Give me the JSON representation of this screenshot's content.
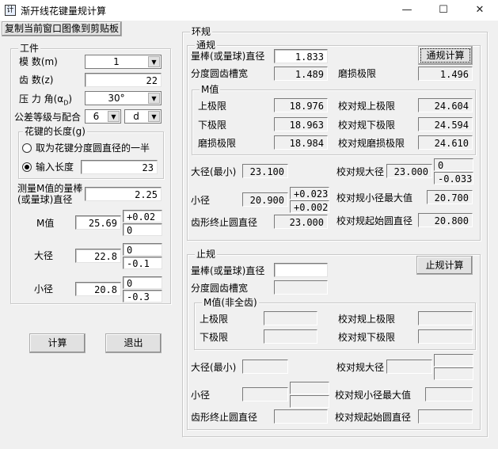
{
  "window": {
    "title": "渐开线花键量规计算",
    "minimize": "—",
    "maximize": "☐",
    "close": "✕",
    "icon": "计"
  },
  "toolbar": {
    "copy_button": "复制当前窗口图像到剪贴板"
  },
  "workpiece": {
    "title": "工件",
    "module_label": "模 数(m)",
    "module_value": "1",
    "teeth_label": "齿 数(z)",
    "teeth_value": "22",
    "pressure_label": "压 力 角(α",
    "pressure_sub": "D",
    "pressure_close": ")",
    "pressure_value": "30°",
    "tolerance_label": "公差等级与配合",
    "tolerance_grade": "6",
    "tolerance_fit": "d",
    "length_group_title": "花键的长度(g)",
    "radio_half": "取为花键分度圆直径的一半",
    "radio_input": "输入长度",
    "length_value": "23",
    "measure_label_1": "测量M值的量棒",
    "measure_label_2": "(或量球)直径",
    "measure_value": "2.25",
    "m_label": "M值",
    "m_value": "25.69",
    "m_upper": "+0.02",
    "m_lower": "0",
    "major_label": "大径",
    "major_value": "22.8",
    "major_upper": "0",
    "major_lower": "-0.1",
    "minor_label": "小径",
    "minor_value": "20.8",
    "minor_upper": "0",
    "minor_lower": "-0.3",
    "calc_button": "计算",
    "exit_button": "退出"
  },
  "ring_gauge": {
    "title": "环规",
    "go": {
      "title": "通规",
      "pin_label": "量棒(或量球)直径",
      "pin_value": "1.833",
      "calc_button": "通规计算",
      "slot_label": "分度圆齿槽宽",
      "slot_value": "1.489",
      "wear_label": "磨损极限",
      "wear_value": "1.496",
      "m_group_title": "M值",
      "upper_label": "上极限",
      "upper_value": "18.976",
      "check_upper_label": "校对规上极限",
      "check_upper_value": "24.604",
      "lower_label": "下极限",
      "lower_value": "18.963",
      "check_lower_label": "校对规下极限",
      "check_lower_value": "24.594",
      "wear_limit_label": "磨损极限",
      "wear_limit_value": "18.984",
      "check_wear_label": "校对规磨损极限",
      "check_wear_value": "24.610",
      "major_min_label": "大径(最小)",
      "major_min_value": "23.100",
      "check_major_label": "校对规大径",
      "check_major_value": "23.000",
      "check_major_upper": "0",
      "check_major_lower": "-0.033",
      "minor_label": "小径",
      "minor_value": "20.900",
      "minor_upper": "+0.023",
      "minor_lower": "+0.002",
      "check_minor_label": "校对规小径最大值",
      "check_minor_value": "20.700",
      "form_end_label": "齿形终止圆直径",
      "form_end_value": "23.000",
      "check_form_start_label": "校对规起始圆直径",
      "check_form_start_value": "20.800"
    },
    "nogo": {
      "title": "止规",
      "pin_label": "量棒(或量球)直径",
      "pin_value": "",
      "calc_button": "止规计算",
      "slot_label": "分度圆齿槽宽",
      "slot_value": "",
      "m_group_title": "M值(非全齿)",
      "upper_label": "上极限",
      "check_upper_label": "校对规上极限",
      "lower_label": "下极限",
      "check_lower_label": "校对规下极限",
      "major_min_label": "大径(最小)",
      "check_major_label": "校对规大径",
      "minor_label": "小径",
      "check_minor_label": "校对规小径最大值",
      "form_end_label": "齿形终止圆直径",
      "check_form_start_label": "校对规起始圆直径"
    }
  }
}
